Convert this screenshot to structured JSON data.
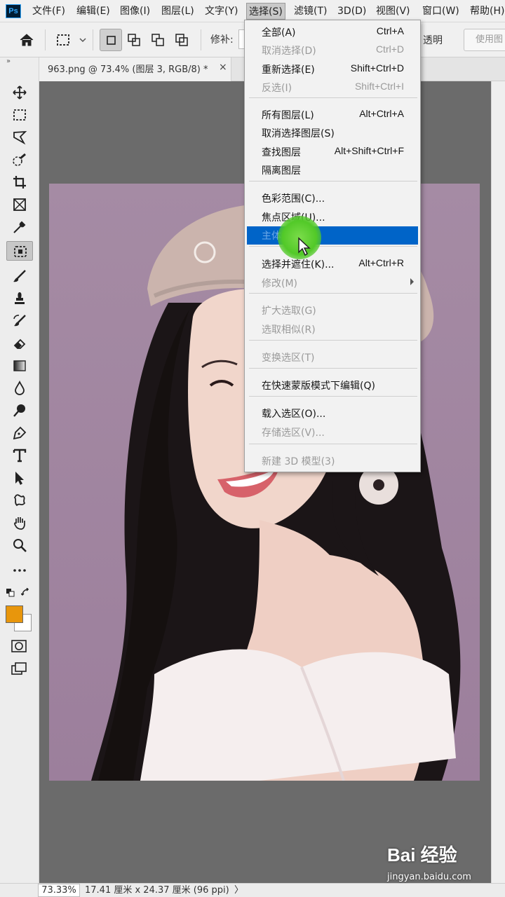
{
  "app": {
    "logo": "Ps"
  },
  "menubar": {
    "items": [
      "文件(F)",
      "编辑(E)",
      "图像(I)",
      "图层(L)",
      "文字(Y)",
      "选择(S)",
      "滤镜(T)",
      "3D(D)",
      "视图(V)",
      "窗口(W)",
      "帮助(H)"
    ],
    "active": "选择(S)"
  },
  "options_bar": {
    "feather_label": "修补:",
    "transparent_label": "透明",
    "use_pattern_label": "使用图"
  },
  "document": {
    "tab_title": "963.png @ 73.4% (图层 3, RGB/8) *",
    "close_glyph": "×"
  },
  "select_menu": {
    "items": [
      {
        "label": "全部(A)",
        "shortcut": "Ctrl+A",
        "enabled": true
      },
      {
        "label": "取消选择(D)",
        "shortcut": "Ctrl+D",
        "enabled": false
      },
      {
        "label": "重新选择(E)",
        "shortcut": "Shift+Ctrl+D",
        "enabled": true
      },
      {
        "label": "反选(I)",
        "shortcut": "Shift+Ctrl+I",
        "enabled": false
      },
      {
        "label": "所有图层(L)",
        "shortcut": "Alt+Ctrl+A",
        "enabled": true
      },
      {
        "label": "取消选择图层(S)",
        "shortcut": "",
        "enabled": true
      },
      {
        "label": "查找图层",
        "shortcut": "Alt+Shift+Ctrl+F",
        "enabled": true
      },
      {
        "label": "隔离图层",
        "shortcut": "",
        "enabled": true
      },
      {
        "label": "色彩范围(C)...",
        "shortcut": "",
        "enabled": true
      },
      {
        "label": "焦点区域(U)...",
        "shortcut": "",
        "enabled": true
      },
      {
        "label": "主体",
        "shortcut": "",
        "enabled": true,
        "highlighted": true
      },
      {
        "label": "选择并遮住(K)...",
        "shortcut": "Alt+Ctrl+R",
        "enabled": true
      },
      {
        "label": "修改(M)",
        "shortcut": "",
        "enabled": false,
        "submenu": true
      },
      {
        "label": "扩大选取(G)",
        "shortcut": "",
        "enabled": false
      },
      {
        "label": "选取相似(R)",
        "shortcut": "",
        "enabled": false
      },
      {
        "label": "变换选区(T)",
        "shortcut": "",
        "enabled": false
      },
      {
        "label": "在快速蒙版模式下编辑(Q)",
        "shortcut": "",
        "enabled": true
      },
      {
        "label": "载入选区(O)...",
        "shortcut": "",
        "enabled": true
      },
      {
        "label": "存储选区(V)...",
        "shortcut": "",
        "enabled": false
      },
      {
        "label": "新建 3D 模型(3)",
        "shortcut": "",
        "enabled": false
      }
    ]
  },
  "status_bar": {
    "zoom": "73.33%",
    "doc_info": "17.41 厘米 x 24.37 厘米 (96 ppi)",
    "arrow": "〉"
  },
  "colors": {
    "foreground": "#e8960c",
    "background": "#ffffff",
    "highlight": "#0064c8"
  },
  "watermark": {
    "brand": "Bai 经验",
    "url": "jingyan.baidu.com"
  }
}
